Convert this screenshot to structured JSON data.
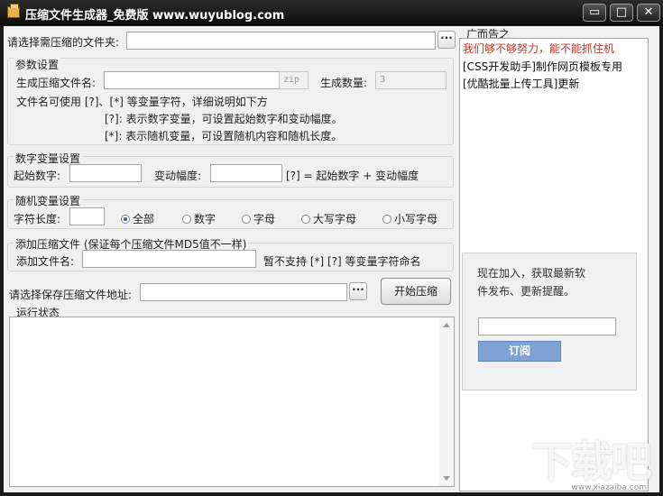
{
  "window": {
    "title": "压缩文件生成器_免费版 www.wuyublog.com",
    "minimize_glyph": "▭",
    "maximize_glyph": "□",
    "close_glyph": "✕"
  },
  "folder": {
    "label": "请选择需压缩的文件夹:",
    "value": "",
    "browse_label": "···"
  },
  "params": {
    "title": "参数设置",
    "name_label": "生成压缩文件名:",
    "name_value": "",
    "ext_placeholder": "zip",
    "count_label": "生成数量:",
    "count_value": "3",
    "hint_line1": "文件名可使用 [?]、[*] 等变量字符，详细说明如下方",
    "hint_line2": "[?]: 表示数字变量，可设置起始数字和变动幅度。",
    "hint_line3": "[*]: 表示随机变量，可设置随机内容和随机长度。"
  },
  "numeric": {
    "title": "数字变量设置",
    "start_label": "起始数字:",
    "start_value": "",
    "step_label": "变动幅度:",
    "step_value": "",
    "formula": "[?] = 起始数字 + 变动幅度"
  },
  "random": {
    "title": "随机变量设置",
    "length_label": "字符长度:",
    "length_value": "",
    "options": [
      {
        "label": "全部",
        "checked": true
      },
      {
        "label": "数字",
        "checked": false
      },
      {
        "label": "字母",
        "checked": false
      },
      {
        "label": "大写字母",
        "checked": false
      },
      {
        "label": "小写字母",
        "checked": false
      }
    ]
  },
  "addfile": {
    "title": "添加压缩文件 (保证每个压缩文件MD5值不一样)",
    "name_label": "添加文件名:",
    "name_value": "",
    "note": "暂不支持 [*] [?] 等变量字符命名"
  },
  "save": {
    "label": "请选择保存压缩文件地址:",
    "value": "",
    "browse_label": "···",
    "start_button": "开始压缩"
  },
  "status": {
    "title": "运行状态",
    "content": ""
  },
  "ads": {
    "title": "广而告之",
    "links": [
      {
        "text": "我们够不够努力，能不能抓住机",
        "color": "#c0392b"
      },
      {
        "text": "[CSS开发助手]制作网页模板专用",
        "color": "#111111"
      },
      {
        "text": "[优酷批量上传工具]更新",
        "color": "#111111"
      }
    ]
  },
  "subscribe": {
    "text": "现在加入，获取最新软件发布、更新提醒。",
    "email_value": "",
    "button_label": "订阅"
  },
  "watermark": {
    "text": "下载吧",
    "sub": "www.xiazaiba.com"
  }
}
